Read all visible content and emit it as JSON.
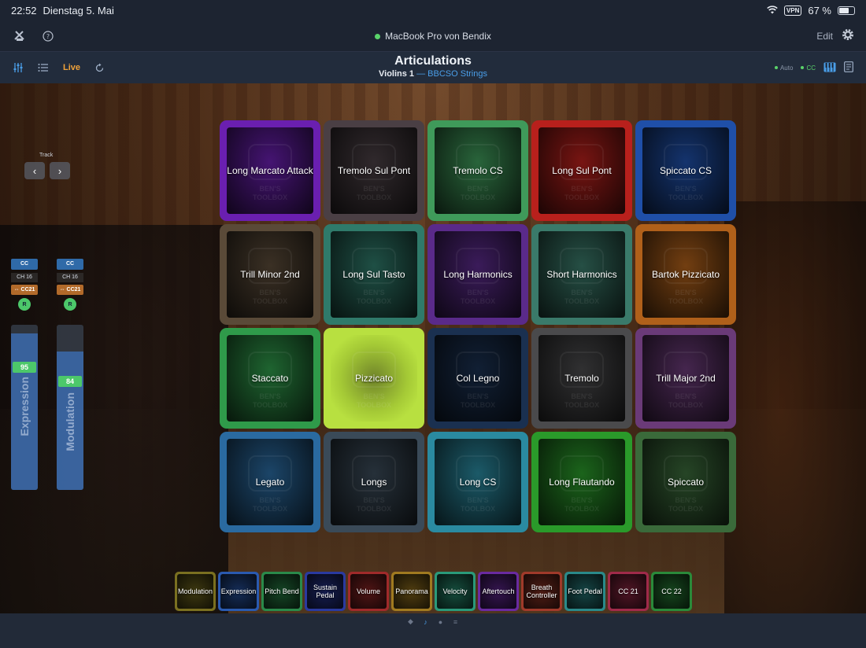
{
  "status": {
    "time": "22:52",
    "date": "Dienstag 5. Mai",
    "vpn": "VPN",
    "battery": "67 %",
    "battery_level": 0.67
  },
  "topbar": {
    "connection": "MacBook Pro von Bendix",
    "edit_label": "Edit"
  },
  "toolbar": {
    "live_label": "Live",
    "title": "Articulations",
    "track": "Violins 1",
    "separator": "—",
    "instrument": "BBCSO Strings",
    "auto_label": "Auto",
    "cc_label": "CC"
  },
  "track_nav": {
    "label": "Track"
  },
  "sliders": [
    {
      "tag": "CC",
      "channel": "CH 16",
      "cc": "⇔ CC21",
      "r": "R",
      "value": "95",
      "level": 0.95,
      "label": "Expression"
    },
    {
      "tag": "CC",
      "channel": "CH 16",
      "cc": "⇔ CC21",
      "r": "R",
      "value": "84",
      "level": 0.84,
      "label": "Modulation"
    }
  ],
  "watermark": {
    "line1": "BEN'S",
    "line2": "TOOLBOX"
  },
  "pads": [
    {
      "label": "Long Marcato Attack",
      "color": "#6a1fb0"
    },
    {
      "label": "Tremolo Sul Pont",
      "color": "#4a3f44"
    },
    {
      "label": "Tremolo CS",
      "color": "#3f9a5a"
    },
    {
      "label": "Long Sul Pont",
      "color": "#b8201c"
    },
    {
      "label": "Spiccato CS",
      "color": "#1f4fa8"
    },
    {
      "label": "Trill Minor 2nd",
      "color": "#5a4a38"
    },
    {
      "label": "Long Sul Tasto",
      "color": "#2f7a6a"
    },
    {
      "label": "Long Harmonics",
      "color": "#5a2a8a"
    },
    {
      "label": "Short Harmonics",
      "color": "#3a7a6a"
    },
    {
      "label": "Bartok Pizzicato",
      "color": "#b0601a"
    },
    {
      "label": "Staccato",
      "color": "#2f9a4a"
    },
    {
      "label": "Pizzicato",
      "color": "#b8e040"
    },
    {
      "label": "Col Legno",
      "color": "#1a3050"
    },
    {
      "label": "Tremolo",
      "color": "#4a4a4c"
    },
    {
      "label": "Trill Major 2nd",
      "color": "#6a3a78"
    },
    {
      "label": "Legato",
      "color": "#2a6aa0"
    },
    {
      "label": "Longs",
      "color": "#3a4a58"
    },
    {
      "label": "Long CS",
      "color": "#2a8aa0"
    },
    {
      "label": "Long Flautando",
      "color": "#2a9a2a"
    },
    {
      "label": "Spiccato",
      "color": "#3a6a3a"
    }
  ],
  "controllers": [
    {
      "label": "Modulation",
      "color": "#7a7020"
    },
    {
      "label": "Expression",
      "color": "#2a5ab0"
    },
    {
      "label": "Pitch Bend",
      "color": "#2a8a4a"
    },
    {
      "label": "Sustain Pedal",
      "color": "#2a3aa0"
    },
    {
      "label": "Volume",
      "color": "#a02a2a"
    },
    {
      "label": "Panorama",
      "color": "#a07a20"
    },
    {
      "label": "Velocity",
      "color": "#2a9a7a"
    },
    {
      "label": "Aftertouch",
      "color": "#6a2aa0"
    },
    {
      "label": "Breath Controller",
      "color": "#a03a2a"
    },
    {
      "label": "Foot Pedal",
      "color": "#2a8a8a"
    },
    {
      "label": "CC 21",
      "color": "#a02a4a"
    },
    {
      "label": "CC 22",
      "color": "#2a8a3a"
    }
  ],
  "pages": {
    "count": 4,
    "active": 1
  }
}
